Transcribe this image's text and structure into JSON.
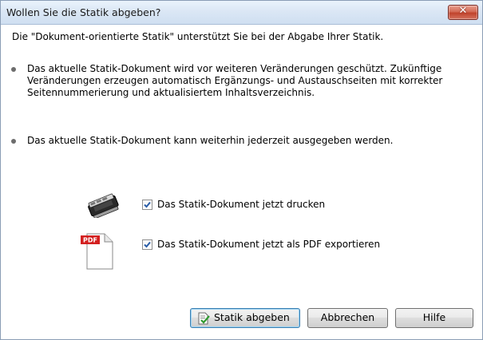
{
  "window": {
    "title": "Wollen Sie die Statik abgeben?"
  },
  "body": {
    "intro": "Die \"Dokument-orientierte Statik\" unterstützt Sie bei der Abgabe Ihrer Statik.",
    "bullets": [
      "Das aktuelle Statik-Dokument wird vor weiteren Veränderungen geschützt. Zukünftige Veränderungen erzeugen automatisch Ergänzungs- und Austauschseiten mit korrekter Seitennummerierung und aktualisiertem Inhaltsverzeichnis.",
      "Das aktuelle Statik-Dokument kann weiterhin jederzeit ausgegeben werden."
    ]
  },
  "options": [
    {
      "label": "Das Statik-Dokument jetzt drucken",
      "checked": true,
      "icon": "printer-icon"
    },
    {
      "label": "Das Statik-Dokument jetzt als PDF exportieren",
      "checked": true,
      "icon": "pdf-document-icon",
      "icon_badge": "PDF"
    }
  ],
  "buttons": {
    "submit": "Statik abgeben",
    "cancel": "Abbrechen",
    "help": "Hilfe"
  },
  "colors": {
    "titlebar": "#dbe7f5",
    "close_button": "#c0432c",
    "checkbox_check": "#2a5da8",
    "pdf_badge": "#d32020"
  }
}
